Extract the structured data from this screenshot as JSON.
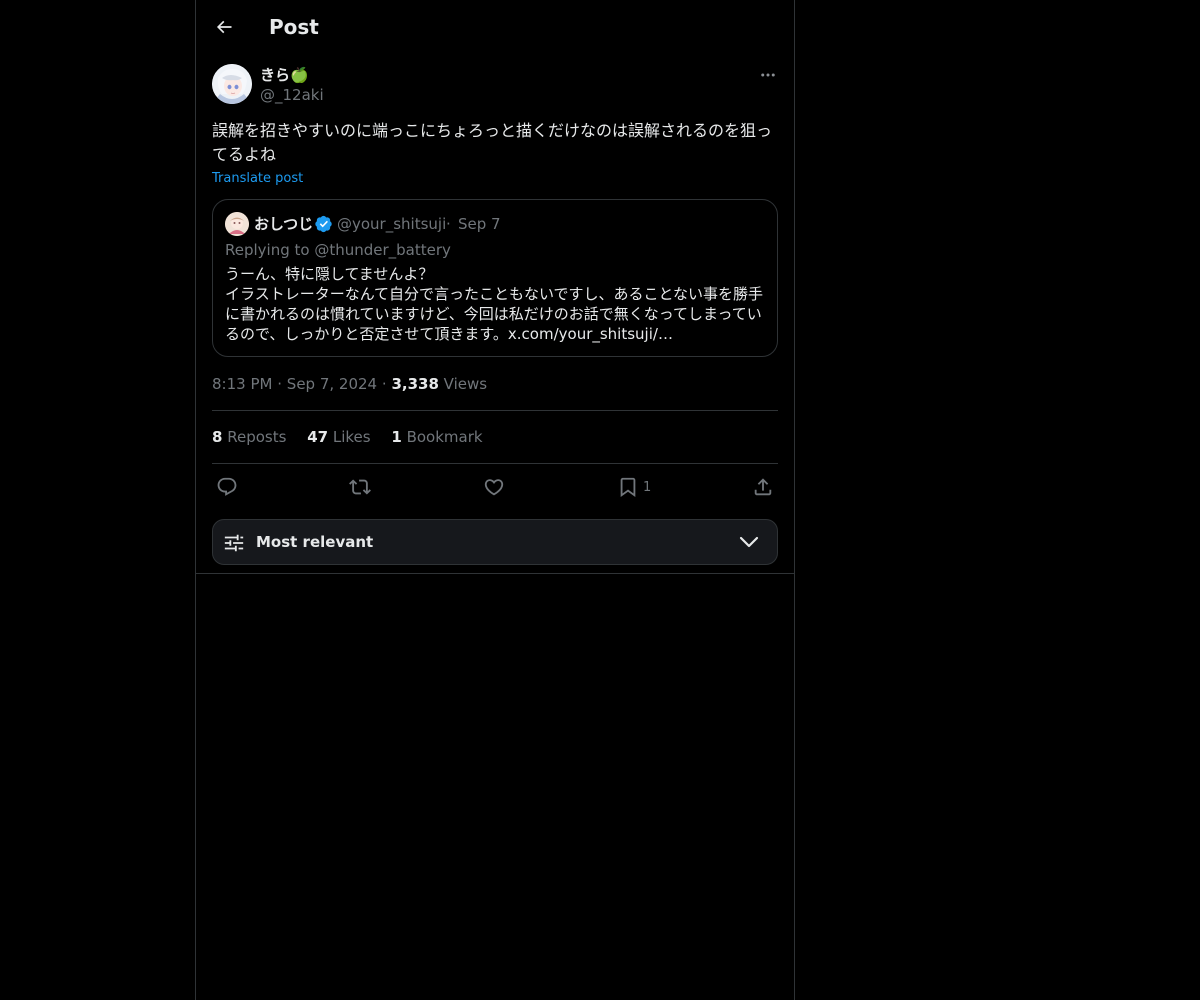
{
  "header": {
    "title": "Post",
    "back_icon": "arrow-left-icon"
  },
  "post": {
    "author_name": "きら🍏",
    "author_handle": "@_12aki",
    "text": "誤解を招きやすいのに端っこにちょろっと描くだけなのは誤解されるのを狙ってるよね",
    "translate_label": "Translate post",
    "time": "8:13 PM",
    "date": "Sep 7, 2024",
    "views_count": "3,338",
    "views_label": "Views",
    "separator": "·"
  },
  "quote": {
    "author_name": "おしつじ",
    "author_handle": "@your_shitsuji",
    "separator": "·",
    "date": "Sep 7",
    "replying_to": "Replying to @thunder_battery",
    "lines": [
      "うーん、特に隠してませんよ？",
      "イラストレーターなんて自分で言ったこともないですし、あることない事を勝手に書かれるのは慣れていますけど、今回は私だけのお話で無くなってしまっているので、しっかりと否定させて頂きます。x.com/your_shitsuji/…"
    ],
    "verified": true,
    "badge_color": "#1d9bf0"
  },
  "stats": {
    "reposts_count": "8",
    "reposts_label": "Reposts",
    "likes_count": "47",
    "likes_label": "Likes",
    "bookmarks_count": "1",
    "bookmarks_label": "Bookmark"
  },
  "actions": {
    "reply_icon": "reply-icon",
    "repost_icon": "repost-icon",
    "like_icon": "heart-icon",
    "bookmark_icon": "bookmark-icon",
    "bookmark_count": "1",
    "share_icon": "share-icon"
  },
  "sort": {
    "label": "Most relevant",
    "icon": "sliders-icon",
    "chevron": "chevron-down-icon"
  },
  "colors": {
    "background": "#000000",
    "text_primary": "#e7e9ea",
    "text_secondary": "#71767b",
    "border": "#2f3336",
    "accent": "#1d9bf0"
  }
}
